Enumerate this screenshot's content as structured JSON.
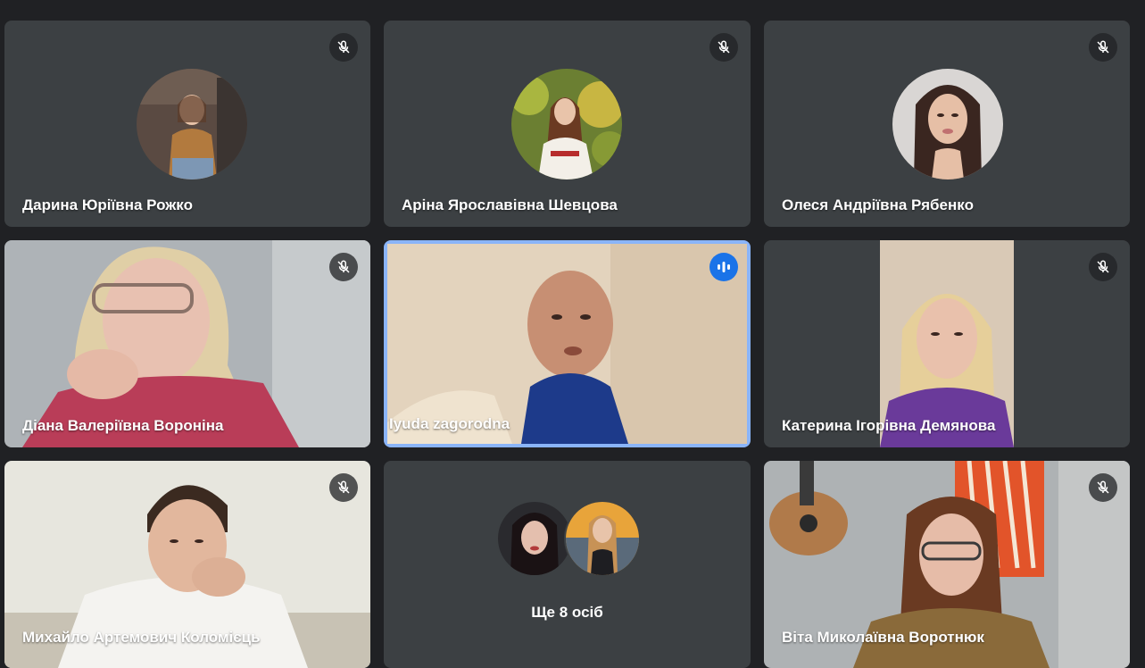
{
  "participants": [
    {
      "name": "Дарина Юріївна Рожко",
      "muted": true
    },
    {
      "name": "Аріна Ярославівна Шевцова",
      "muted": true
    },
    {
      "name": "Олеся Андріївна Рябенко",
      "muted": true
    },
    {
      "name": "Діана Валеріївна Вороніна",
      "muted": true
    },
    {
      "name": "Iyuda zagorodna",
      "muted": false,
      "speaking": true
    },
    {
      "name": "Катерина Ігорівна Демянова",
      "muted": true
    },
    {
      "name": "Михайло Артемович Коломієць",
      "muted": true
    },
    {
      "name": "Віта Миколаївна Воротнюк",
      "muted": true
    }
  ],
  "overflow": {
    "label": "Ще 8 осіб"
  },
  "icons": {
    "muted": "mic-off-icon",
    "speaking": "audio-level-icon"
  },
  "colors": {
    "background": "#202124",
    "tile": "#3c4043",
    "active_border": "#8ab4f8",
    "speaking_badge": "#1a73e8"
  }
}
